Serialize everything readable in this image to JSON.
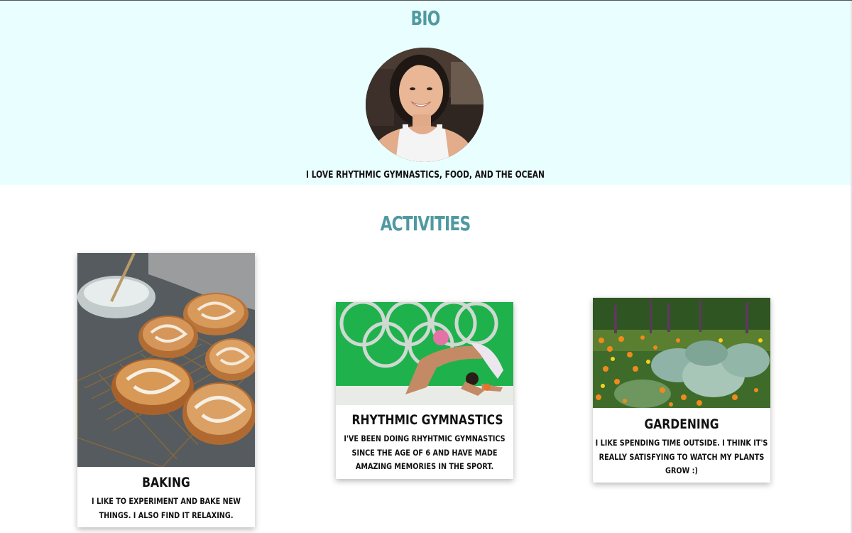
{
  "bio": {
    "title": "BIO",
    "text": "I LOVE RHYTHMIC GYMNASTICS, FOOD, AND THE OCEAN"
  },
  "activities": {
    "title": "ACTIVITIES",
    "items": [
      {
        "title": "BAKING",
        "description": "I LIKE TO EXPERIMENT AND BAKE NEW THINGS. I ALSO FIND IT RELAXING."
      },
      {
        "title": "RHYTHMIC GYMNASTICS",
        "description": "I'VE BEEN DOING RHYHTMIC GYMNASTICS SINCE THE AGE OF 6 AND HAVE MADE AMAZING MEMORIES IN THE SPORT."
      },
      {
        "title": "GARDENING",
        "description": "I LIKE SPENDING TIME OUTSIDE. I THINK IT'S REALLY SATISFYING TO WATCH MY PLANTS GROW :)"
      }
    ]
  },
  "colors": {
    "bio_background": "#e9fefe",
    "heading": "#4f9aa0",
    "text": "#111111"
  }
}
